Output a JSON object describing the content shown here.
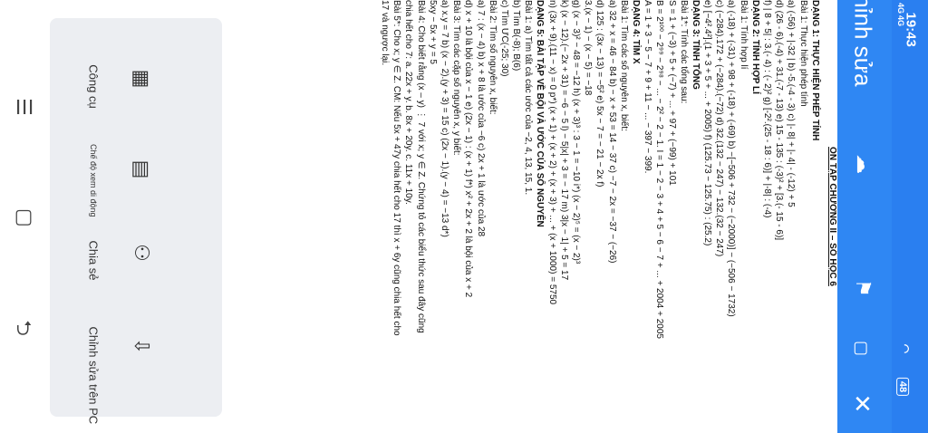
{
  "status": {
    "time": "19:43",
    "signal1": "4G",
    "signal2": "4G",
    "battery": "48"
  },
  "header": {
    "title": "Chỉnh sửa"
  },
  "doc": {
    "title": "ÔN TẬP CHƯƠNG II – SỐ HỌC 6",
    "lines": [
      {
        "t": "DẠNG 1: THỰC HIỆN PHÉP TÍNH",
        "h": true
      },
      {
        "t": "Bài 1: Thực hiện phép tính"
      },
      {
        "t": "a) (-56) + |-32   |        b) -5.(-4 - 3)        c) |- 8| + |- 4| - (-12) + 5"
      },
      {
        "t": "d) (26 - 6).(-4) + 31.(-7 - 13)   e) 15 - 135 : (-3)² + [3.(- 15 - 6)]"
      },
      {
        "t": "f) | 8 + 5| : 3.(- 4) : (- 2)²    g) [-2².(25 - 18 : 6)] + |-8| : (-4)"
      },
      {
        "t": "DẠNG 2: TÍNH HỢP LÍ",
        "h": true
      },
      {
        "t": "Bài 1: Tính hợp lí"
      },
      {
        "t": "a) (-18) + (-31) + 98 + (-18) + (-69)    b) −[−506 + 732 − (−2000)] − (−506 − 1732)"
      },
      {
        "t": "c) (−284).172 + (−284).(−72)    d) 32.(132 − 247) − 132.(32 − 247)"
      },
      {
        "t": "e) [−4².4²].(1 + 3 + 5 + ... + 2005)   f) (125.73 − 125.75) : (25.2)"
      },
      {
        "t": "DẠNG 3: TÍNH TỔNG",
        "h": true
      },
      {
        "t": "Bài 1*: Tính các tổng sau:"
      },
      {
        "t": "S = 1 + (−3) + 5 + (−7) + ... + 97 + (−99) + 101"
      },
      {
        "t": "B = 2¹⁰⁰ − 2⁹⁹ − 2⁹⁸ − ... − 2² − 2 − 1.        I = 1 − 2 − 3 + 4 + 5 − 6 − 7 + ... + 2004 + 2005"
      },
      {
        "t": "A = 1 + 3 − 5 − 7 + 9 + 11 − ... − 397 − 399."
      },
      {
        "t": "DẠNG 4: TÌM X",
        "h": true
      },
      {
        "t": "Bài 1: Tìm các số nguyên x, biết:"
      },
      {
        "t": "a) 32 + x = 46 − 84     b) − x + 53 = 14 − 37     c) −7 − 2x = −37 − (−26)"
      },
      {
        "t": "d) 125 : (3x − 13) = −5²     e) 5x − 7 = − 21 − 2x     f)"
      },
      {
        "t": "3.(x − 1) − (x − 5) = −18"
      },
      {
        "t": "g) (x − 3)² − 48 = −12     h) (x + 3)³ : 3 − 1 = −10     i*) (x − 2)⁵ = (x − 2)³"
      },
      {
        "t": "k) (x − 12).(− 2x + 31) = −6 − 5     l) − 5|x| + 3 = − 17     m) 3|x − 1| + 5 = 17"
      },
      {
        "t": "n) (3x + 9).(11 − x) = 0     p*) (x + 1) + (x + 2) + (x + 3) + ... + (x + 1000) = 5750"
      },
      {
        "t": "DẠNG 5: BÀI TẬP VỀ BỘI VÀ ƯỚC CỦA SỐ NGUYÊN",
        "h": true
      },
      {
        "t": "Bài 1: a) Tìm tất cả các ước của −2, 4, 13, 15, 1."
      },
      {
        "t": "    b) Tìm B(-8); B(6)"
      },
      {
        "t": "    c) Tìm ƯC(-25; 30)"
      },
      {
        "t": "Bài 2: Tìm số nguyên x, biết:"
      },
      {
        "t": "a) 7 : (x − 4)     b) x + 8 là ước của −6     c) 2x + 1 là ước của 28"
      },
      {
        "t": "d) x + 10 là bội của x − 1     e) (2x − 1) : (x + 1)     f*) x² + 2x + 2 là bội của x + 2"
      },
      {
        "t": "Bài 3: Tìm các cặp số nguyên x, y biết:"
      },
      {
        "t": "a) x.y = 7     b) (x − 2).(y + 3) = 15     c) (2x − 1).(y − 4) = −13     d*)"
      },
      {
        "t": "5xy − 5x + y = 5"
      },
      {
        "t": "Bài 4: Cho biết rằng (x – y) ⋮ 7 với x; y ∈ Z. Chứng tỏ các biểu thức sau đây cũng"
      },
      {
        "t": "chia hết cho 7:    a. 22x + y.     b. 8x + 20y.     c. 11x + 10y."
      },
      {
        "t": ""
      },
      {
        "t": "Bài 5*: Cho x; y ∈ Z. CM: Nếu 5x + 47y chia hết cho 17 thì x + 6y cũng chia hết cho"
      },
      {
        "t": "17 và ngược lại."
      }
    ]
  },
  "toolbar": {
    "tools": "Công cụ",
    "read_mode": "Chế độ xem di động",
    "share": "Chia sẻ",
    "edit_pc": "Chỉnh sửa trên PC"
  },
  "colors": {
    "header": "#2f87f3",
    "status": "#2a7ff0",
    "accent_dot": "#e53935"
  }
}
